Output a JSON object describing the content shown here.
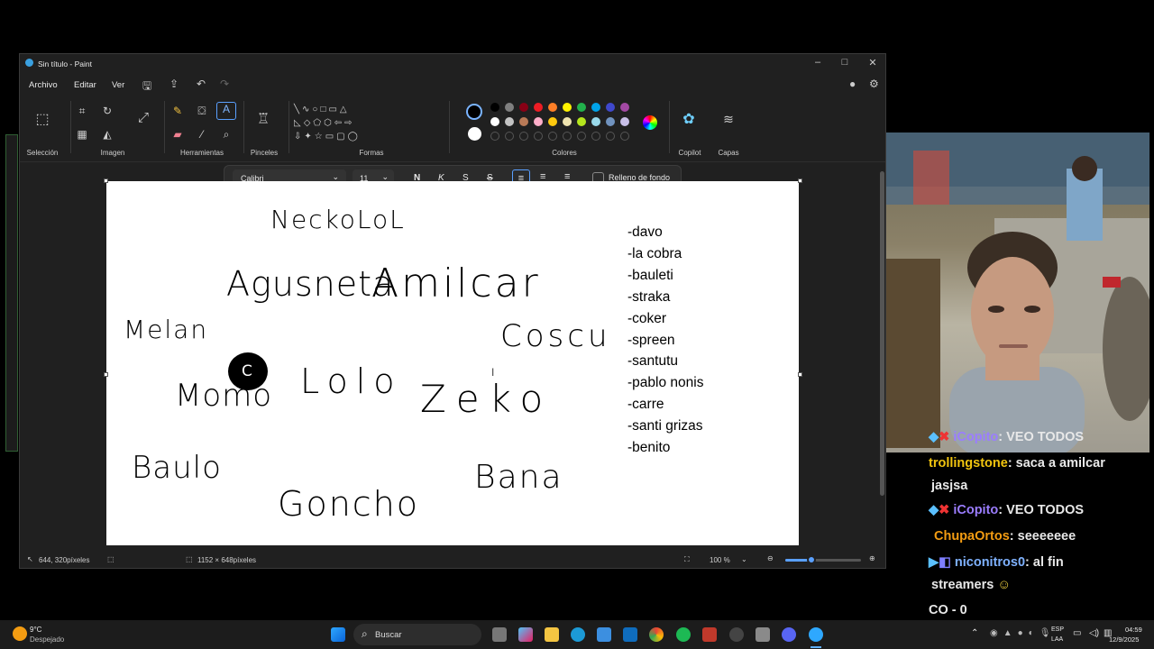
{
  "window": {
    "title": "Sin título - Paint"
  },
  "menu": {
    "file": "Archivo",
    "edit": "Editar",
    "view": "Ver"
  },
  "ribbon": {
    "groups": {
      "selection": "Selección",
      "image": "Imagen",
      "tools": "Herramientas",
      "brushes": "Pinceles",
      "shapes": "Formas",
      "colors": "Colores",
      "copilot": "Copilot",
      "layers": "Capas"
    }
  },
  "palette": {
    "row1": [
      "#000000",
      "#7f7f7f",
      "#880015",
      "#ed1c24",
      "#ff7f27",
      "#fff200",
      "#22b14c",
      "#00a2e8",
      "#3f48cc",
      "#a349a4"
    ],
    "row2": [
      "#ffffff",
      "#c3c3c3",
      "#b97a57",
      "#ffaec9",
      "#ffc90e",
      "#efe4b0",
      "#b5e61d",
      "#99d9ea",
      "#7092be",
      "#c8bfe7"
    ],
    "primary": "#000000",
    "secondary": "#ffffff"
  },
  "text_toolbar": {
    "font": "Calibri",
    "size": "11",
    "bold": "N",
    "italic": "K",
    "underline": "S",
    "strike": "S",
    "fill_label": "Relleno de fondo"
  },
  "canvas": {
    "names": {
      "neckolol": "NeckoLoL",
      "agusneta": "Agusneta",
      "amilcar": "Amilcar",
      "melan": "Melan",
      "coscu": "Coscu",
      "momo": "Momo",
      "lolo": "Lolo",
      "zeko": "Zeko",
      "baulo": "Baulo",
      "bana": "Bana",
      "goncho": "Goncho"
    },
    "list": [
      "-davo",
      "-la cobra",
      "-bauleti",
      "-straka",
      "-coker",
      "-spreen",
      "-santutu",
      "-pablo nonis",
      "-carre",
      "-santi grizas",
      "-benito"
    ]
  },
  "status": {
    "cursor": "644, 320píxeles",
    "size": "1152 × 648píxeles",
    "zoom": "100 %",
    "zoom_level_fraction": 0.35
  },
  "chat": [
    {
      "user": "iCopito",
      "msg": ": VEO TODOS"
    },
    {
      "user": "trollingstone",
      "msg": ": saca a amilcar"
    },
    {
      "cont": "jasjsa"
    },
    {
      "user": "iCopito",
      "msg": ": VEO TODOS"
    },
    {
      "user": "ChupaOrtos",
      "msg": ": seeeeeee"
    },
    {
      "user": "niconitros0",
      "msg": ": al fin"
    },
    {
      "cont": "streamers"
    },
    {
      "cont": "CO - 0"
    }
  ],
  "taskbar": {
    "weather_temp": "9°C",
    "weather_desc": "Despejado",
    "search": "Buscar",
    "lang1": "ESP",
    "lang2": "LAA",
    "time": "04:59",
    "date": "12/9/2025"
  }
}
